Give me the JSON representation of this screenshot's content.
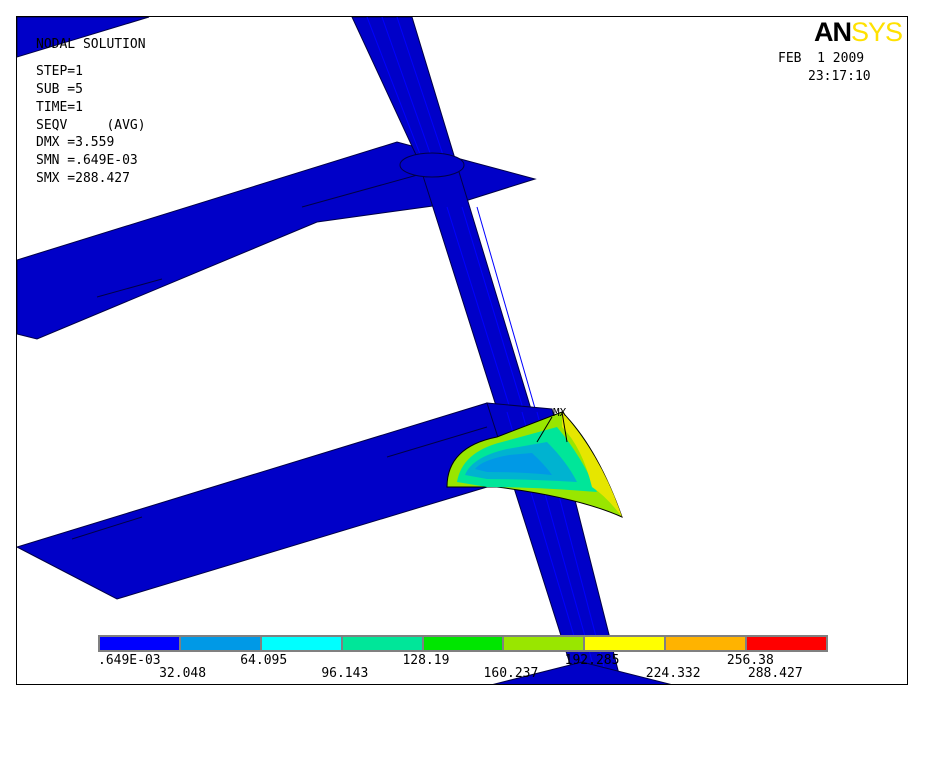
{
  "info": {
    "title": "NODAL SOLUTION",
    "step": "STEP=1",
    "sub": "SUB =5",
    "time": "TIME=1",
    "seqv": "SEQV     (AVG)",
    "dmx": "DMX =3.559",
    "smn": "SMN =.649E-03",
    "smx": "SMX =288.427"
  },
  "header": {
    "logo_an": "AN",
    "logo_sys": "SYS",
    "date": "FEB  1 2009",
    "time": "23:17:10"
  },
  "marker": {
    "mx_label": "MX"
  },
  "legend": {
    "colors": [
      "#0000ff",
      "#0099e6",
      "#00ffff",
      "#00e699",
      "#00e600",
      "#99e600",
      "#ffff00",
      "#ffb300",
      "#ff0000"
    ],
    "labels_top": [
      ".649E-03",
      "64.095",
      "128.19",
      "192.285",
      "256.38"
    ],
    "labels_bottom": [
      "32.048",
      "96.143",
      "160.237",
      "224.332",
      "288.427"
    ]
  },
  "colors": {
    "model_blue": "#0000c8",
    "edge_dark": "#000046"
  }
}
